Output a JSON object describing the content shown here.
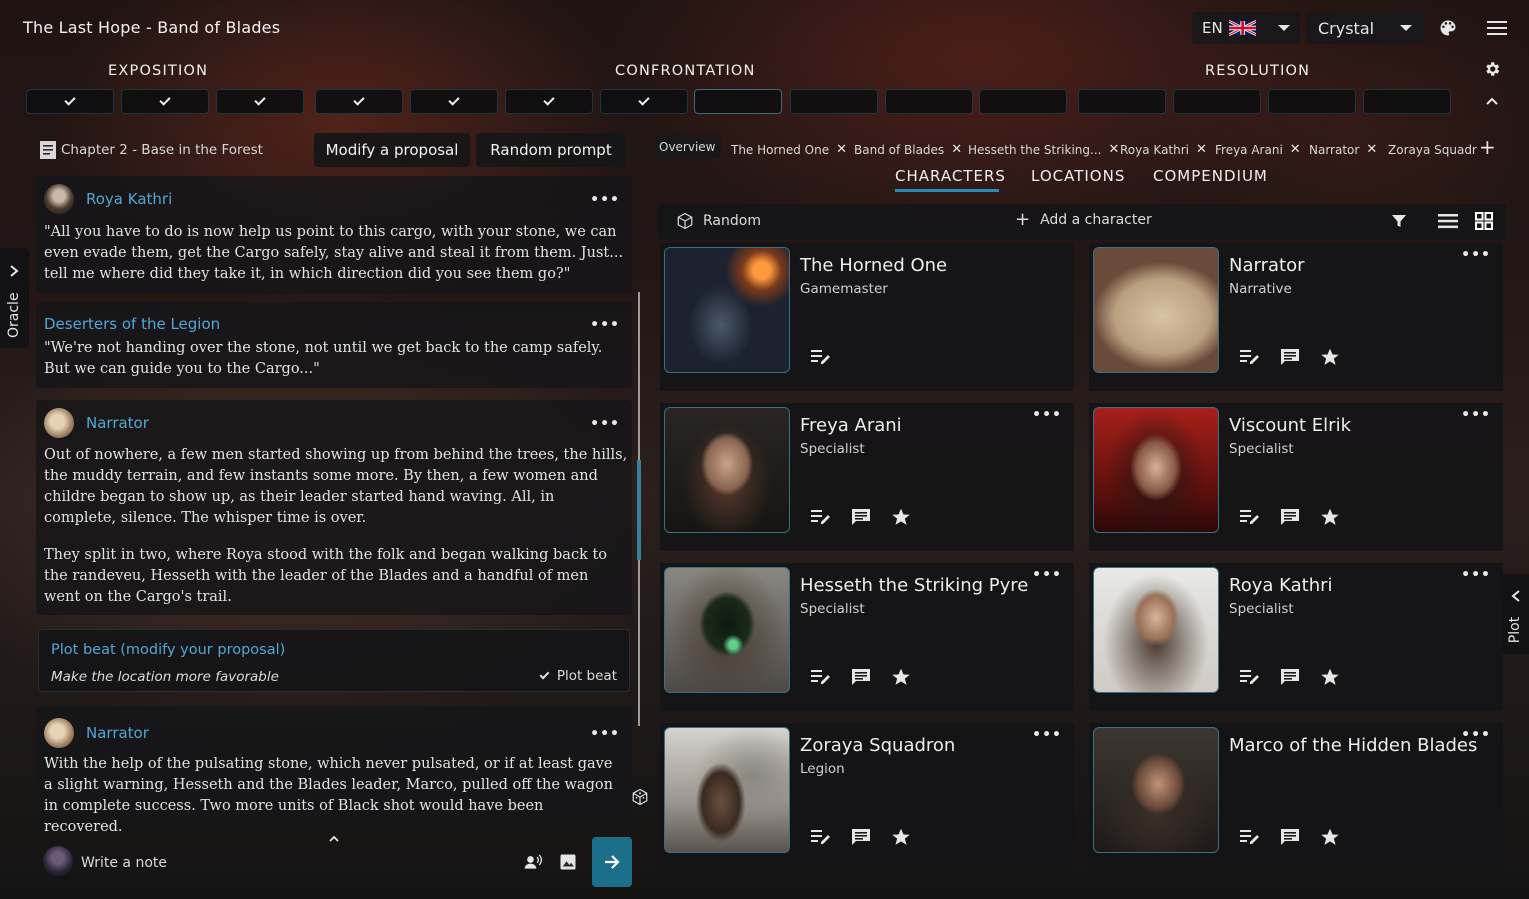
{
  "app": {
    "title": "The Last Hope - Band of Blades"
  },
  "header": {
    "language": "EN",
    "theme": "Crystal"
  },
  "acts": {
    "exposition": "EXPOSITION",
    "confrontation": "CONFRONTATION",
    "resolution": "RESOLUTION"
  },
  "progress": {
    "completed": 7,
    "total": 15
  },
  "sidebar": {
    "oracle": "Oracle",
    "plot": "Plot"
  },
  "chapter": {
    "title": "Chapter 2 - Base in the Forest"
  },
  "buttons": {
    "modify": "Modify a proposal",
    "random_prompt": "Random prompt"
  },
  "messages": [
    {
      "speaker": "Roya Kathri",
      "text": "\"All you have to do is now help us point to this cargo, with your stone, we can even evade them, get the Cargo safely, stay alive and steal it from them. Just... tell me where did they take it, in which direction did you see them go?\""
    },
    {
      "speaker": "Deserters of the Legion",
      "text": "\"We're not handing over the stone, not until we get back to the camp safely. But we can guide you to the Cargo...\""
    },
    {
      "speaker": "Narrator",
      "text": "Out of nowhere, a few men started showing up from behind the trees, the hills, the muddy terrain, and few instants some more. By then, a few women and childre began to show up, as their leader started hand waving. All, in complete, silence. The whisper time is over.",
      "text2": "They split in two, where Roya stood with the folk and began walking back to the randeveu, Hesseth with the leader of the Blades and a handful of men went on the Cargo's trail."
    },
    {
      "speaker": "Narrator",
      "text": "With the help of the pulsating stone, which never pulsated, or if at least gave a slight warning, Hesseth and the Blades leader, Marco, pulled off the wagon in complete success. Two more units of Black shot would have been recovered."
    }
  ],
  "plot_beat": {
    "title": "Plot beat (modify your proposal)",
    "detail": "Make the location more favorable",
    "tag": "Plot beat"
  },
  "note": {
    "placeholder": "Write a note"
  },
  "tabs": [
    "Overview",
    "The Horned One",
    "Band of Blades",
    "Hesseth the Striking...",
    "Roya Kathri",
    "Freya Arani",
    "Narrator",
    "Zoraya Squadr"
  ],
  "nav": {
    "characters": "CHARACTERS",
    "locations": "LOCATIONS",
    "compendium": "COMPENDIUM"
  },
  "toolbar": {
    "random": "Random",
    "add_character": "Add a character"
  },
  "characters": [
    {
      "name": "The Horned One",
      "role": "Gamemaster"
    },
    {
      "name": "Narrator",
      "role": "Narrative"
    },
    {
      "name": "Freya Arani",
      "role": "Specialist"
    },
    {
      "name": "Viscount Elrik",
      "role": "Specialist"
    },
    {
      "name": "Hesseth the Striking Pyre",
      "role": "Specialist"
    },
    {
      "name": "Roya Kathri",
      "role": "Specialist"
    },
    {
      "name": "Zoraya Squadron",
      "role": "Legion"
    },
    {
      "name": "Marco of the Hidden Blades",
      "role": ""
    }
  ],
  "colors": {
    "accent": "#4fa8d6",
    "send": "#1b6f89",
    "panel": "#161618"
  }
}
